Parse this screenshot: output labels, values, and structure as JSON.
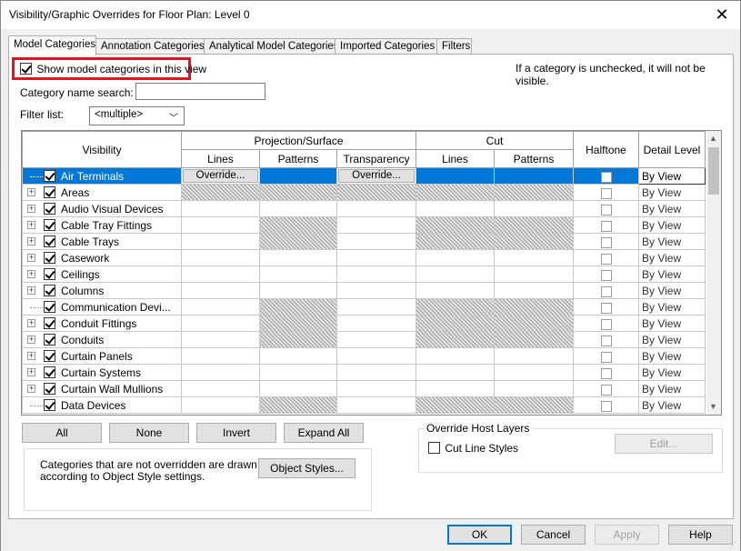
{
  "window": {
    "title": "Visibility/Graphic Overrides for Floor Plan: Level 0",
    "close": "✕"
  },
  "tabs": [
    "Model Categories",
    "Annotation Categories",
    "Analytical Model Categories",
    "Imported Categories",
    "Filters"
  ],
  "show_categories_label": "Show model categories in this view",
  "hint_text": "If a category is unchecked, it will not be visible.",
  "search": {
    "label": "Category name search:",
    "value": ""
  },
  "filter": {
    "label": "Filter list:",
    "value": "<multiple>"
  },
  "grid": {
    "headers": {
      "visibility": "Visibility",
      "projection": "Projection/Surface",
      "cut": "Cut",
      "halftone": "Halftone",
      "detail_level": "Detail Level",
      "lines": "Lines",
      "patterns": "Patterns",
      "transparency": "Transparency",
      "cut_lines": "Lines",
      "cut_patterns": "Patterns"
    },
    "override_label": "Override...",
    "rows": [
      {
        "name": "Air Terminals",
        "detail": "By View"
      },
      {
        "name": "Areas",
        "detail": "By View"
      },
      {
        "name": "Audio Visual Devices",
        "detail": "By View"
      },
      {
        "name": "Cable Tray Fittings",
        "detail": "By View"
      },
      {
        "name": "Cable Trays",
        "detail": "By View"
      },
      {
        "name": "Casework",
        "detail": "By View"
      },
      {
        "name": "Ceilings",
        "detail": "By View"
      },
      {
        "name": "Columns",
        "detail": "By View"
      },
      {
        "name": "Communication Devi...",
        "detail": "By View"
      },
      {
        "name": "Conduit Fittings",
        "detail": "By View"
      },
      {
        "name": "Conduits",
        "detail": "By View"
      },
      {
        "name": "Curtain Panels",
        "detail": "By View"
      },
      {
        "name": "Curtain Systems",
        "detail": "By View"
      },
      {
        "name": "Curtain Wall Mullions",
        "detail": "By View"
      },
      {
        "name": "Data Devices",
        "detail": "By View"
      }
    ]
  },
  "buttons": {
    "all": "All",
    "none": "None",
    "invert": "Invert",
    "expand_all": "Expand All",
    "object_styles": "Object Styles...",
    "edit": "Edit...",
    "ok": "OK",
    "cancel": "Cancel",
    "apply": "Apply",
    "help": "Help"
  },
  "host_layers": {
    "title": "Override Host Layers",
    "cut_line_styles": "Cut Line Styles"
  },
  "note": {
    "line1": "Categories that are not overridden are drawn",
    "line2": "according to Object Style settings."
  }
}
